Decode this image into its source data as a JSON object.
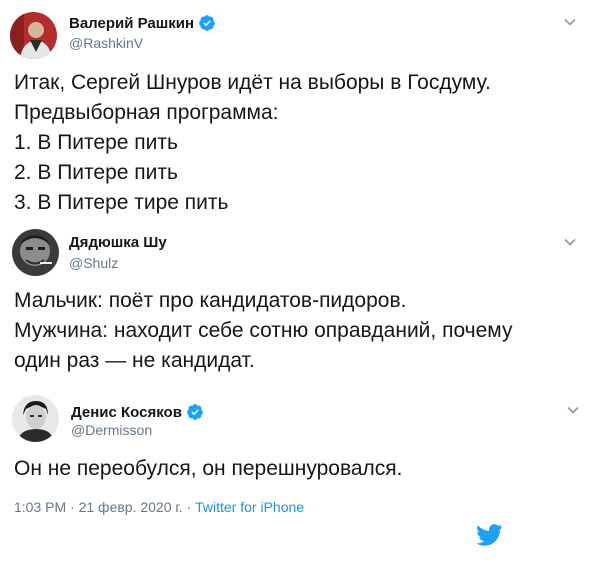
{
  "tweets": [
    {
      "display_name": "Валерий Рашкин",
      "handle": "@RashkinV",
      "verified": true,
      "lines": [
        "Итак, Сергей Шнуров идёт на выборы в Госдуму.",
        "Предвыборная программа:",
        "1. В Питере пить",
        "2. В Питере пить",
        "3. В Питере тире пить"
      ]
    },
    {
      "display_name": "Дядюшка Шу",
      "handle": "@Shulz",
      "verified": false,
      "lines": [
        "Мальчик: поёт про кандидатов-пидоров.",
        "Мужчина: находит себе сотню оправданий, почему",
        "один раз — не кандидат."
      ]
    },
    {
      "display_name": "Денис Косяков",
      "handle": "@Dermisson",
      "verified": true,
      "lines": [
        "Он не переобулся, он перешнуровался."
      ]
    }
  ],
  "footer": {
    "time": "1:03 PM",
    "separator": " · ",
    "date": "21 февр. 2020 г.",
    "separator2": " · ",
    "source": "Twitter for iPhone"
  },
  "icons": {
    "verified": "verified-badge-icon",
    "chevron": "chevron-down-icon",
    "brand": "twitter-bird-icon"
  },
  "colors": {
    "accent": "#1da1f2",
    "link": "#1b95e0",
    "secondary_text": "#657786",
    "primary_text": "#14171a"
  }
}
